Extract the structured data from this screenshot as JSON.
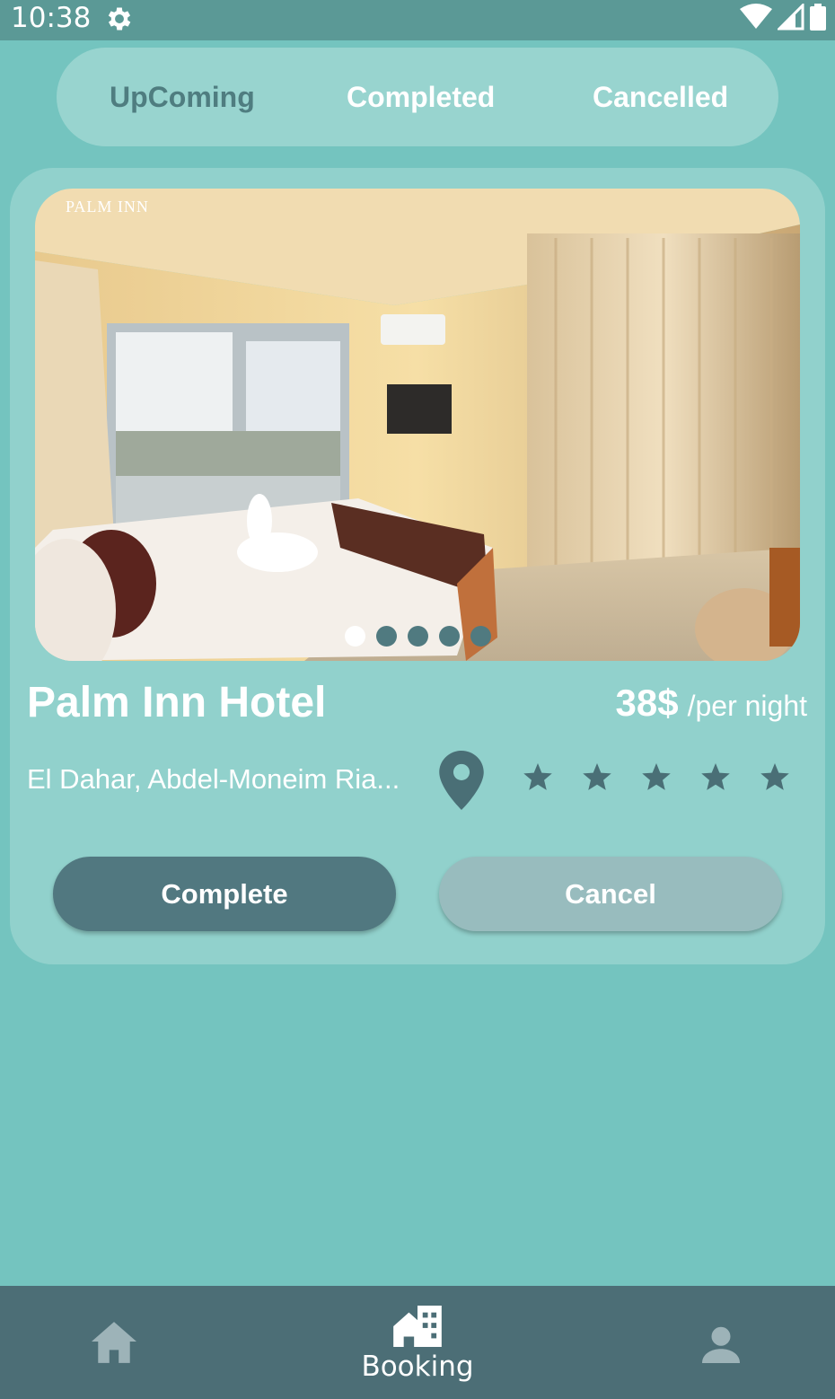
{
  "status_bar": {
    "time": "10:38",
    "icons": [
      "gear-icon",
      "wifi-icon",
      "signal-icon",
      "battery-icon"
    ]
  },
  "tabs": [
    {
      "label": "UpComing",
      "active": true
    },
    {
      "label": "Completed",
      "active": false
    },
    {
      "label": "Cancelled",
      "active": false
    }
  ],
  "booking": {
    "photo_logo": "PALM INN",
    "carousel": {
      "count": 5,
      "active_index": 0
    },
    "hotel_name": "Palm Inn Hotel",
    "price": "38$",
    "price_unit": "/per night",
    "address": "El Dahar, Abdel-Moneim Ria...",
    "rating_stars": 5,
    "complete_label": "Complete",
    "cancel_label": "Cancel"
  },
  "bottom_nav": {
    "items": [
      {
        "icon": "home-icon",
        "label": ""
      },
      {
        "icon": "booking-icon",
        "label": "Booking",
        "active": true
      },
      {
        "icon": "profile-icon",
        "label": ""
      }
    ]
  },
  "colors": {
    "background": "#74c4bf",
    "status_bar": "#5b9996",
    "card": "#91d1cc",
    "tab_bar": "#98d4cf",
    "primary_button": "#517880",
    "secondary_button": "#98bcbe",
    "bottom_nav": "#4c6e76",
    "icon_dark": "#4a6f76"
  }
}
